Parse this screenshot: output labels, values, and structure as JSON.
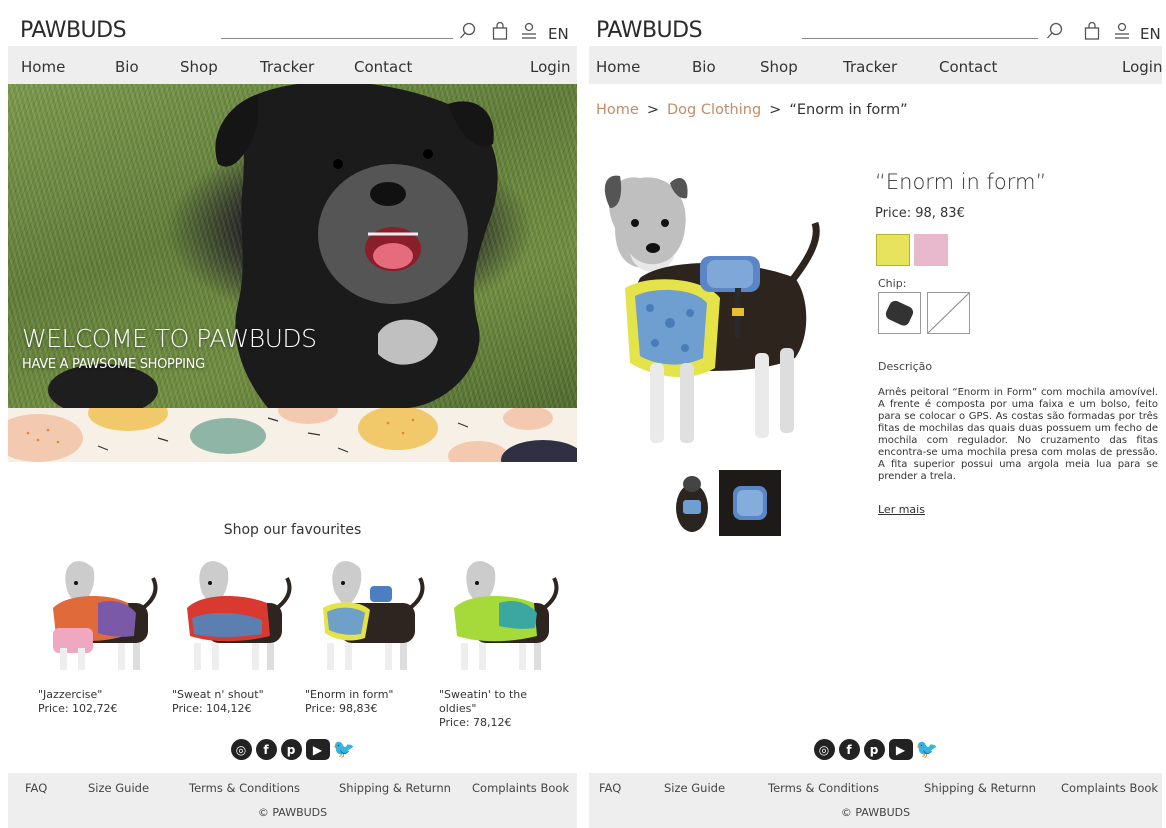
{
  "header": {
    "logo": "PAWBUDS",
    "lang": "EN"
  },
  "nav": {
    "home": "Home",
    "bio": "Bio",
    "shop": "Shop",
    "tracker": "Tracker",
    "contact": "Contact",
    "login": "Login"
  },
  "hero": {
    "title": "WELCOME TO PAWBUDS",
    "subtitle": "HAVE A PAWSOME SHOPPING"
  },
  "favourites": {
    "title": "Shop our favourites",
    "items": [
      {
        "name": "\"Jazzercise\"",
        "price": "Price: 102,72€"
      },
      {
        "name": "\"Sweat n' shout\"",
        "price": "Price: 104,12€"
      },
      {
        "name": "\"Enorm in form\"",
        "price": "Price: 98,83€"
      },
      {
        "name": "\"Sweatin' to the oldies\"",
        "price": "Price: 78,12€"
      }
    ]
  },
  "footer": {
    "faq": "FAQ",
    "size_guide": "Size Guide",
    "terms": "Terms & Conditions",
    "shipping": "Shipping & Returnn",
    "complaints": "Complaints Book",
    "copyright": "© PAWBUDS"
  },
  "breadcrumb": {
    "home": "Home",
    "category": "Dog Clothing",
    "current": "“Enorm in form”",
    "sep": ">"
  },
  "product": {
    "title": "“Enorm in form”",
    "price": "Price: 98, 83€",
    "colors": [
      "#e7e35c",
      "#e8b8cc"
    ],
    "chip_label": "Chip:",
    "description_label": "Descrição",
    "description": "Arnês peitoral “Enorm in Form” com mochila amovível. A frente é composta por uma faixa e um bolso, feito para se colocar o GPS. As costas são formadas por três fitas de mochilas das quais duas possuem um fecho de mochila com regulador. No cruzamento das fitas encontra-se uma mochila presa com molas de pressão. A fita superior possui uma argola meia lua para se prender a trela.",
    "read_more": "Ler mais"
  },
  "socials": [
    "instagram-icon",
    "facebook-icon",
    "pinterest-icon",
    "youtube-icon",
    "twitter-icon"
  ]
}
